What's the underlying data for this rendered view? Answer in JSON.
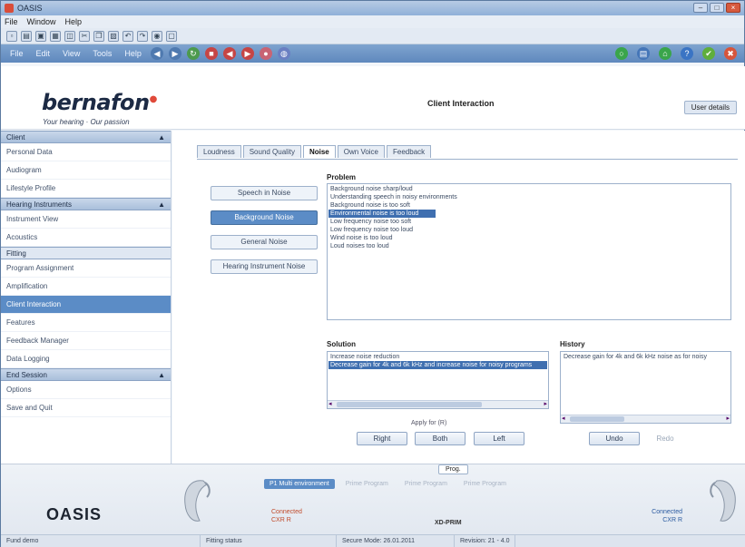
{
  "window": {
    "title": "OASIS"
  },
  "menu": [
    "File",
    "Window",
    "Help"
  ],
  "toolbar2": {
    "items": [
      "File",
      "Edit",
      "View",
      "Tools",
      "Help"
    ]
  },
  "brand": {
    "logo": "bernafon",
    "slogan": "Your hearing · Our passion"
  },
  "header": {
    "title": "Client Interaction",
    "user_button": "User details"
  },
  "sidebar": {
    "sections": [
      {
        "label": "Client",
        "items": [
          "Personal Data",
          "Audiogram",
          "Lifestyle Profile"
        ]
      },
      {
        "label": "Hearing Instruments",
        "items": [
          "Instrument View",
          "Acoustics"
        ]
      },
      {
        "label": "Fitting",
        "items": [
          "Program Assignment",
          "Amplification",
          "Client Interaction",
          "Features",
          "Feedback Manager",
          "Data Logging"
        ]
      },
      {
        "label": "End Session",
        "items": [
          "Options",
          "Save and Quit"
        ]
      }
    ]
  },
  "tabs": [
    "Loudness",
    "Sound Quality",
    "Noise",
    "Own Voice",
    "Feedback"
  ],
  "side_buttons": [
    "Speech in Noise",
    "Background Noise",
    "General Noise",
    "Hearing Instrument Noise"
  ],
  "problem": {
    "label": "Problem",
    "items": [
      "Background noise sharp/loud",
      "Understanding speech in noisy environments",
      "Background noise is too soft",
      "Environmental noise is too loud",
      "Low frequency noise too soft",
      "Low frequency noise too loud",
      "Wind noise is too loud",
      "Loud noises too loud"
    ],
    "selected_index": 3
  },
  "solution": {
    "label": "Solution",
    "items": [
      "Increase noise reduction",
      "Decrease gain for 4k and 6k kHz and increase noise for noisy programs"
    ],
    "selected_index": 1
  },
  "history": {
    "label": "History",
    "items": [
      "Decrease gain for 4k and 6k kHz noise as for noisy"
    ]
  },
  "actions": {
    "apply_label": "Apply for (R)",
    "right": "Right",
    "both": "Both",
    "left": "Left",
    "undo": "Undo",
    "redo": "Redo"
  },
  "bottom": {
    "brand": "OASIS",
    "program_button": "Prog.",
    "programs": [
      "P1 Multi environment",
      "Prime Program",
      "Prime Program",
      "Prime Program"
    ],
    "active_program": 0,
    "left_status": [
      "Connected",
      "CXR R"
    ],
    "right_status": [
      "Connected",
      "CXR R"
    ],
    "model": "XD-PRIM"
  },
  "statusbar": [
    "Fund demo",
    "Fitting status",
    "Secure Mode: 26.01.2011",
    "Revision: 21 - 4.0"
  ],
  "colors": {
    "accent": "#5b8cc6",
    "selection": "#3f6fb0",
    "brand_red": "#e04a3a"
  }
}
